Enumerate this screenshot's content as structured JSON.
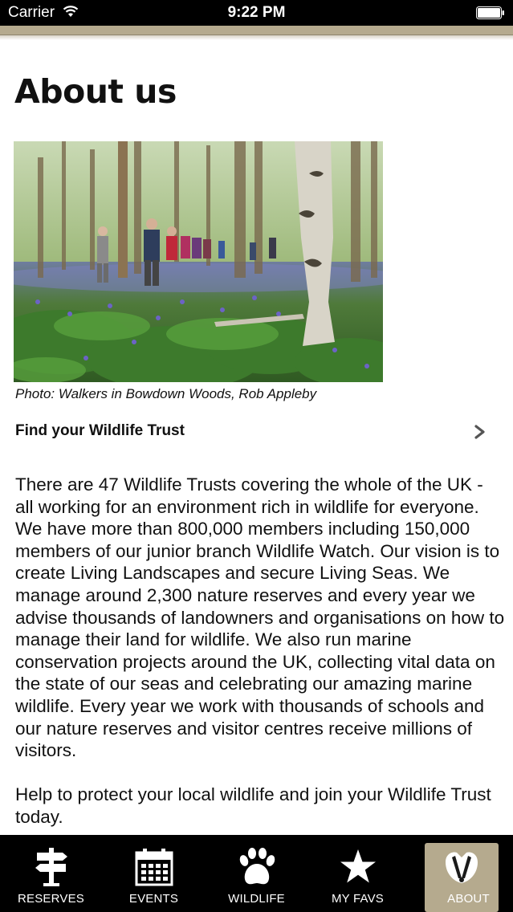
{
  "status_bar": {
    "carrier": "Carrier",
    "time": "9:22 PM"
  },
  "colors": {
    "header_accent": "#b5aa8e",
    "tab_bar_bg": "#000000",
    "active_tab_bg": "#b5aa8e"
  },
  "page": {
    "title": "About us",
    "photo_caption": "Photo: Walkers in Bowdown Woods, Rob Appleby",
    "find_trust_label": "Find your Wildlife Trust",
    "paragraphs": [
      "There are 47 Wildlife Trusts covering the whole of the UK - all working for an environment rich in wildlife for everyone.  We have more than 800,000 members including 150,000 members of our junior branch Wildlife Watch.  Our vision is to create Living Landscapes and secure Living Seas.  We manage around 2,300 nature reserves and every year we advise thousands of landowners and organisations on how to manage their land for wildlife. We also run marine conservation projects around the UK, collecting vital data on the state of our seas and celebrating our amazing marine wildlife.  Every year we work with thousands of schools and our nature reserves and visitor centres receive millions of visitors.",
      "Help to protect your local wildlife and join your Wildlife Trust today."
    ]
  },
  "tabs": [
    {
      "label": "RESERVES",
      "icon": "signpost-icon",
      "active": false
    },
    {
      "label": "EVENTS",
      "icon": "calendar-icon",
      "active": false
    },
    {
      "label": "WILDLIFE",
      "icon": "paw-print-icon",
      "active": false
    },
    {
      "label": "MY FAVS",
      "icon": "star-icon",
      "active": false
    },
    {
      "label": "ABOUT",
      "icon": "badger-icon",
      "active": true
    }
  ]
}
